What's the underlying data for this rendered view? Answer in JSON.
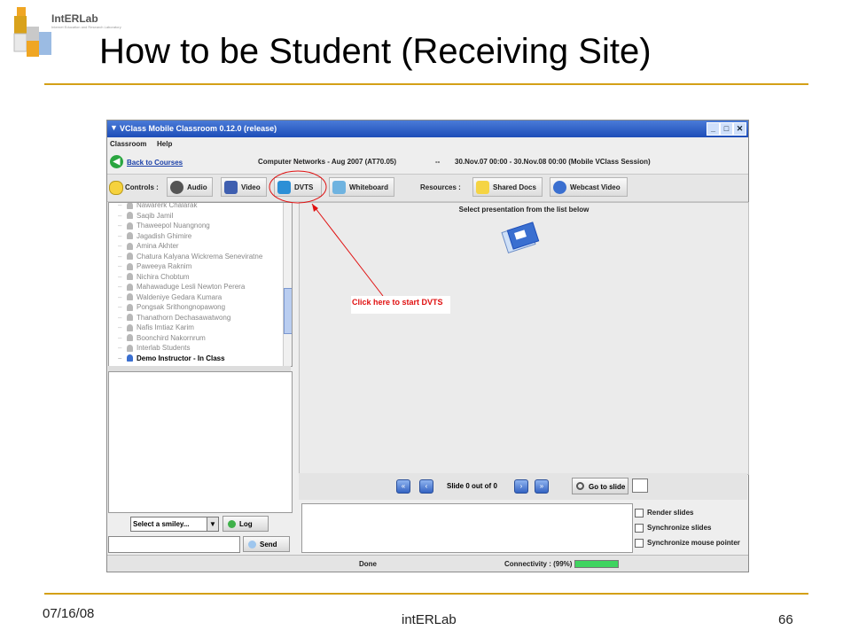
{
  "slide": {
    "title": "How to be Student (Receiving Site)",
    "logo_text": "IntERLab",
    "logo_sub": "Internet Education and Research Laboratory",
    "footer_date": "07/16/08",
    "footer_org": "intERLab",
    "page_number": "66"
  },
  "window": {
    "title": "VClass Mobile Classroom 0.12.0 (release)",
    "menu": [
      "Classroom",
      "Help"
    ],
    "back_link": "Back to Courses",
    "course": "Computer Networks - Aug 2007 (AT70.05)",
    "separator": "--",
    "session": "30.Nov.07 00:00 - 30.Nov.08 00:00 (Mobile VClass Session)"
  },
  "toolbar": {
    "controls_label": "Controls :",
    "audio": "Audio",
    "video": "Video",
    "dvts": "DVTS",
    "whiteboard": "Whiteboard",
    "resources_label": "Resources :",
    "shared_docs": "Shared Docs",
    "webcast_video": "Webcast Video"
  },
  "users": [
    {
      "name": "Nawarerk Chalarak",
      "active": false
    },
    {
      "name": "Saqib Jamil",
      "active": false
    },
    {
      "name": "Thaweepol Nuangnong",
      "active": false
    },
    {
      "name": "Jagadish Ghimire",
      "active": false
    },
    {
      "name": "Amina Akhter",
      "active": false
    },
    {
      "name": "Chatura Kalyana Wickrema Seneviratne",
      "active": false
    },
    {
      "name": "Paweeya Raknim",
      "active": false
    },
    {
      "name": "Nichira Chobtum",
      "active": false
    },
    {
      "name": "Mahawaduge Lesli Newton Perera",
      "active": false
    },
    {
      "name": "Waldeniye Gedara Kumara",
      "active": false
    },
    {
      "name": "Pongsak Srithongnopawong",
      "active": false
    },
    {
      "name": "Thanathorn Dechasawatwong",
      "active": false
    },
    {
      "name": "Nafis Imtiaz Karim",
      "active": false
    },
    {
      "name": "Boonchird Nakornrum",
      "active": false
    },
    {
      "name": "Interlab Students",
      "active": false
    },
    {
      "name": "Demo Instructor -  In Class",
      "active": true
    }
  ],
  "chat": {
    "smiley_select": "Select a smiley...",
    "log_button": "Log",
    "send_button": "Send",
    "input_value": ""
  },
  "presentation": {
    "message": "Select presentation from the list below",
    "slide_counter": "Slide 0 out of 0",
    "goto_button": "Go to slide",
    "slide_input": ""
  },
  "options": {
    "render_slides": "Render slides",
    "synchronize_slides": "Synchronize slides",
    "synchronize_pointer": "Synchronize mouse pointer"
  },
  "status": {
    "text": "Done",
    "connectivity_label": "Connectivity : (99%)",
    "connectivity_value": 0.99
  },
  "annotation": {
    "callout": "Click here to start DVTS",
    "color": "#e01010"
  },
  "colors": {
    "rule": "#d4a017",
    "titlebar": "#1d4db8"
  }
}
